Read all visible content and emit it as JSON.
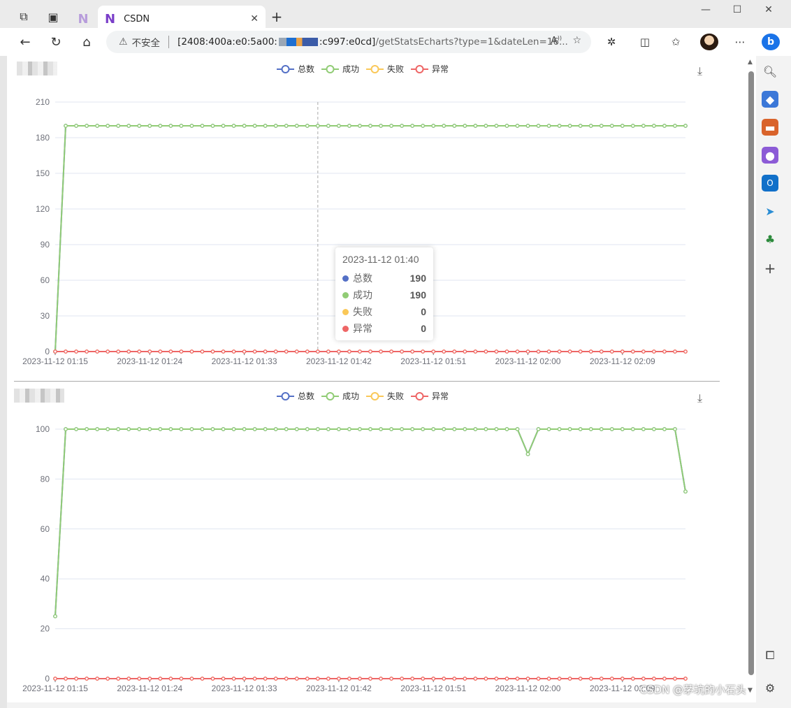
{
  "browser": {
    "inactive_tab_icon": "N",
    "active_tab_icon": "N",
    "active_tab_title": "CSDN",
    "new_tab_label": "+",
    "security_label": "不安全",
    "url_host_start": "[2408:400a:e0:5a00:",
    "url_host_end": ":c997:e0cd]",
    "url_path": "/getStatsEcharts?type=1&dateLen=16..."
  },
  "legend": [
    {
      "name": "总数",
      "color": "#5470c6"
    },
    {
      "name": "成功",
      "color": "#91cc75"
    },
    {
      "name": "失败",
      "color": "#fac858"
    },
    {
      "name": "异常",
      "color": "#ee6666"
    }
  ],
  "tooltip": {
    "title": "2023-11-12 01:40",
    "rows": [
      {
        "name": "总数",
        "value": "190",
        "color": "#5470c6"
      },
      {
        "name": "成功",
        "value": "190",
        "color": "#91cc75"
      },
      {
        "name": "失败",
        "value": "0",
        "color": "#fac858"
      },
      {
        "name": "异常",
        "value": "0",
        "color": "#ee6666"
      }
    ]
  },
  "watermark": "CSDN @茅坑的小石头",
  "chart_data": [
    {
      "type": "line",
      "title": "",
      "x_tick_labels": [
        "2023-11-12 01:15",
        "2023-11-12 01:24",
        "2023-11-12 01:33",
        "2023-11-12 01:42",
        "2023-11-12 01:51",
        "2023-11-12 02:00",
        "2023-11-12 02:09"
      ],
      "ylim": [
        0,
        210
      ],
      "yticks": [
        0,
        30,
        60,
        90,
        120,
        150,
        180,
        210
      ],
      "point_count": 61,
      "x_start": "2023-11-12 01:15",
      "x_step_minutes": 1,
      "grid": true,
      "legend_position": "top-center",
      "series": [
        {
          "name": "总数",
          "color": "#5470c6",
          "values": [
            0,
            190,
            190,
            190,
            190,
            190,
            190,
            190,
            190,
            190,
            190,
            190,
            190,
            190,
            190,
            190,
            190,
            190,
            190,
            190,
            190,
            190,
            190,
            190,
            190,
            190,
            190,
            190,
            190,
            190,
            190,
            190,
            190,
            190,
            190,
            190,
            190,
            190,
            190,
            190,
            190,
            190,
            190,
            190,
            190,
            190,
            190,
            190,
            190,
            190,
            190,
            190,
            190,
            190,
            190,
            190,
            190,
            190,
            190,
            190,
            190
          ]
        },
        {
          "name": "成功",
          "color": "#91cc75",
          "values": [
            0,
            190,
            190,
            190,
            190,
            190,
            190,
            190,
            190,
            190,
            190,
            190,
            190,
            190,
            190,
            190,
            190,
            190,
            190,
            190,
            190,
            190,
            190,
            190,
            190,
            190,
            190,
            190,
            190,
            190,
            190,
            190,
            190,
            190,
            190,
            190,
            190,
            190,
            190,
            190,
            190,
            190,
            190,
            190,
            190,
            190,
            190,
            190,
            190,
            190,
            190,
            190,
            190,
            190,
            190,
            190,
            190,
            190,
            190,
            190,
            190
          ]
        },
        {
          "name": "失败",
          "color": "#fac858",
          "values": [
            0,
            0,
            0,
            0,
            0,
            0,
            0,
            0,
            0,
            0,
            0,
            0,
            0,
            0,
            0,
            0,
            0,
            0,
            0,
            0,
            0,
            0,
            0,
            0,
            0,
            0,
            0,
            0,
            0,
            0,
            0,
            0,
            0,
            0,
            0,
            0,
            0,
            0,
            0,
            0,
            0,
            0,
            0,
            0,
            0,
            0,
            0,
            0,
            0,
            0,
            0,
            0,
            0,
            0,
            0,
            0,
            0,
            0,
            0,
            0,
            0
          ]
        },
        {
          "name": "异常",
          "color": "#ee6666",
          "values": [
            0,
            0,
            0,
            0,
            0,
            0,
            0,
            0,
            0,
            0,
            0,
            0,
            0,
            0,
            0,
            0,
            0,
            0,
            0,
            0,
            0,
            0,
            0,
            0,
            0,
            0,
            0,
            0,
            0,
            0,
            0,
            0,
            0,
            0,
            0,
            0,
            0,
            0,
            0,
            0,
            0,
            0,
            0,
            0,
            0,
            0,
            0,
            0,
            0,
            0,
            0,
            0,
            0,
            0,
            0,
            0,
            0,
            0,
            0,
            0,
            0
          ]
        }
      ],
      "highlight": {
        "x": "2023-11-12 01:40"
      }
    },
    {
      "type": "line",
      "title": "",
      "x_tick_labels": [
        "2023-11-12 01:15",
        "2023-11-12 01:24",
        "2023-11-12 01:33",
        "2023-11-12 01:42",
        "2023-11-12 01:51",
        "2023-11-12 02:00",
        "2023-11-12 02:09"
      ],
      "ylim": [
        0,
        100
      ],
      "yticks": [
        0,
        20,
        40,
        60,
        80,
        100
      ],
      "point_count": 61,
      "x_start": "2023-11-12 01:15",
      "x_step_minutes": 1,
      "grid": true,
      "legend_position": "top-center",
      "series": [
        {
          "name": "总数",
          "color": "#5470c6",
          "values": [
            25,
            100,
            100,
            100,
            100,
            100,
            100,
            100,
            100,
            100,
            100,
            100,
            100,
            100,
            100,
            100,
            100,
            100,
            100,
            100,
            100,
            100,
            100,
            100,
            100,
            100,
            100,
            100,
            100,
            100,
            100,
            100,
            100,
            100,
            100,
            100,
            100,
            100,
            100,
            100,
            100,
            100,
            100,
            100,
            100,
            90,
            100,
            100,
            100,
            100,
            100,
            100,
            100,
            100,
            100,
            100,
            100,
            100,
            100,
            100,
            75
          ]
        },
        {
          "name": "成功",
          "color": "#91cc75",
          "values": [
            25,
            100,
            100,
            100,
            100,
            100,
            100,
            100,
            100,
            100,
            100,
            100,
            100,
            100,
            100,
            100,
            100,
            100,
            100,
            100,
            100,
            100,
            100,
            100,
            100,
            100,
            100,
            100,
            100,
            100,
            100,
            100,
            100,
            100,
            100,
            100,
            100,
            100,
            100,
            100,
            100,
            100,
            100,
            100,
            100,
            90,
            100,
            100,
            100,
            100,
            100,
            100,
            100,
            100,
            100,
            100,
            100,
            100,
            100,
            100,
            75
          ]
        },
        {
          "name": "失败",
          "color": "#fac858",
          "values": [
            0,
            0,
            0,
            0,
            0,
            0,
            0,
            0,
            0,
            0,
            0,
            0,
            0,
            0,
            0,
            0,
            0,
            0,
            0,
            0,
            0,
            0,
            0,
            0,
            0,
            0,
            0,
            0,
            0,
            0,
            0,
            0,
            0,
            0,
            0,
            0,
            0,
            0,
            0,
            0,
            0,
            0,
            0,
            0,
            0,
            0,
            0,
            0,
            0,
            0,
            0,
            0,
            0,
            0,
            0,
            0,
            0,
            0,
            0,
            0,
            0
          ]
        },
        {
          "name": "异常",
          "color": "#ee6666",
          "values": [
            0,
            0,
            0,
            0,
            0,
            0,
            0,
            0,
            0,
            0,
            0,
            0,
            0,
            0,
            0,
            0,
            0,
            0,
            0,
            0,
            0,
            0,
            0,
            0,
            0,
            0,
            0,
            0,
            0,
            0,
            0,
            0,
            0,
            0,
            0,
            0,
            0,
            0,
            0,
            0,
            0,
            0,
            0,
            0,
            0,
            0,
            0,
            0,
            0,
            0,
            0,
            0,
            0,
            0,
            0,
            0,
            0,
            0,
            0,
            0,
            0
          ]
        }
      ]
    }
  ]
}
